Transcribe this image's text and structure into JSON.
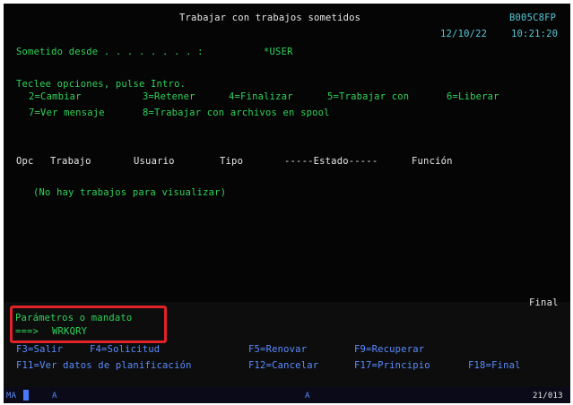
{
  "header": {
    "title": "Trabajar con trabajos sometidos",
    "system": "B005C8FP",
    "date": "12/10/22",
    "time": "10:21:20"
  },
  "filter": {
    "label": "Sometido desde . . . . . . . . :",
    "value": "*USER"
  },
  "instructions": {
    "line1": "Teclee opciones, pulse Intro.",
    "options_row1": [
      "2=Cambiar",
      "3=Retener",
      "4=Finalizar",
      "5=Trabajar con",
      "6=Liberar"
    ],
    "options_row2": [
      "7=Ver mensaje",
      "8=Trabajar con archivos en spool"
    ]
  },
  "columns": [
    "Opc",
    "Trabajo",
    "Usuario",
    "Tipo",
    "-----Estado-----",
    "Función"
  ],
  "empty_message": "(No hay trabajos para visualizar)",
  "list_status": "Final",
  "command": {
    "label": "Parámetros o mandato",
    "prompt": "===>",
    "value": "WRKQRY"
  },
  "function_keys_row1": [
    "F3=Salir",
    "F4=Solicitud",
    "F5=Renovar",
    "F9=Recuperar"
  ],
  "function_keys_row2": [
    "F11=Ver datos de planificación",
    "F12=Cancelar",
    "F17=Principio",
    "F18=Final"
  ],
  "status_bar": {
    "left": "MA",
    "indicator1": "A",
    "indicator2": "A",
    "position": "21/013"
  },
  "colors": {
    "background": "#050505",
    "header_text": "#e6e6e6",
    "field_text": "#2fd35a",
    "highlight": "#e0232b"
  }
}
